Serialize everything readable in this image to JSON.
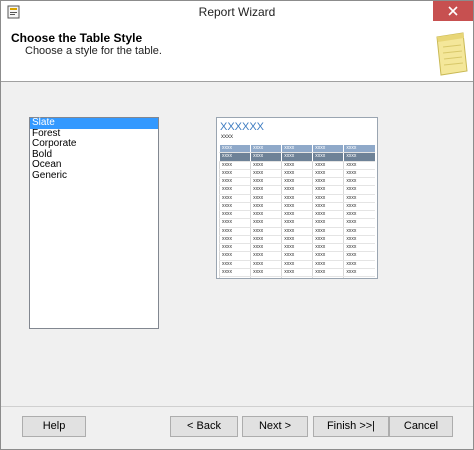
{
  "window": {
    "title": "Report Wizard",
    "close_icon": "close-icon",
    "app_icon": "report-wizard-icon"
  },
  "header": {
    "title": "Choose the Table Style",
    "subtitle": "Choose a style for the table.",
    "icon": "notepad-icon"
  },
  "style_list": {
    "items": [
      {
        "label": "Slate",
        "selected": true
      },
      {
        "label": "Forest",
        "selected": false
      },
      {
        "label": "Corporate",
        "selected": false
      },
      {
        "label": "Bold",
        "selected": false
      },
      {
        "label": "Ocean",
        "selected": false
      },
      {
        "label": "Generic",
        "selected": false
      }
    ]
  },
  "preview": {
    "title": "XXXXXX",
    "subtitle": "xxxx",
    "cell_text": "xxxx",
    "columns": 5,
    "rows": 18,
    "colors": {
      "header_light": "#8fa9c9",
      "header_dark": "#6e8297",
      "title": "#3e7cc1"
    }
  },
  "buttons": {
    "help": "Help",
    "back": "< Back",
    "next": "Next >",
    "finish": "Finish >>|",
    "cancel": "Cancel"
  },
  "colors": {
    "selection": "#3399ff",
    "close_button": "#c75050"
  }
}
